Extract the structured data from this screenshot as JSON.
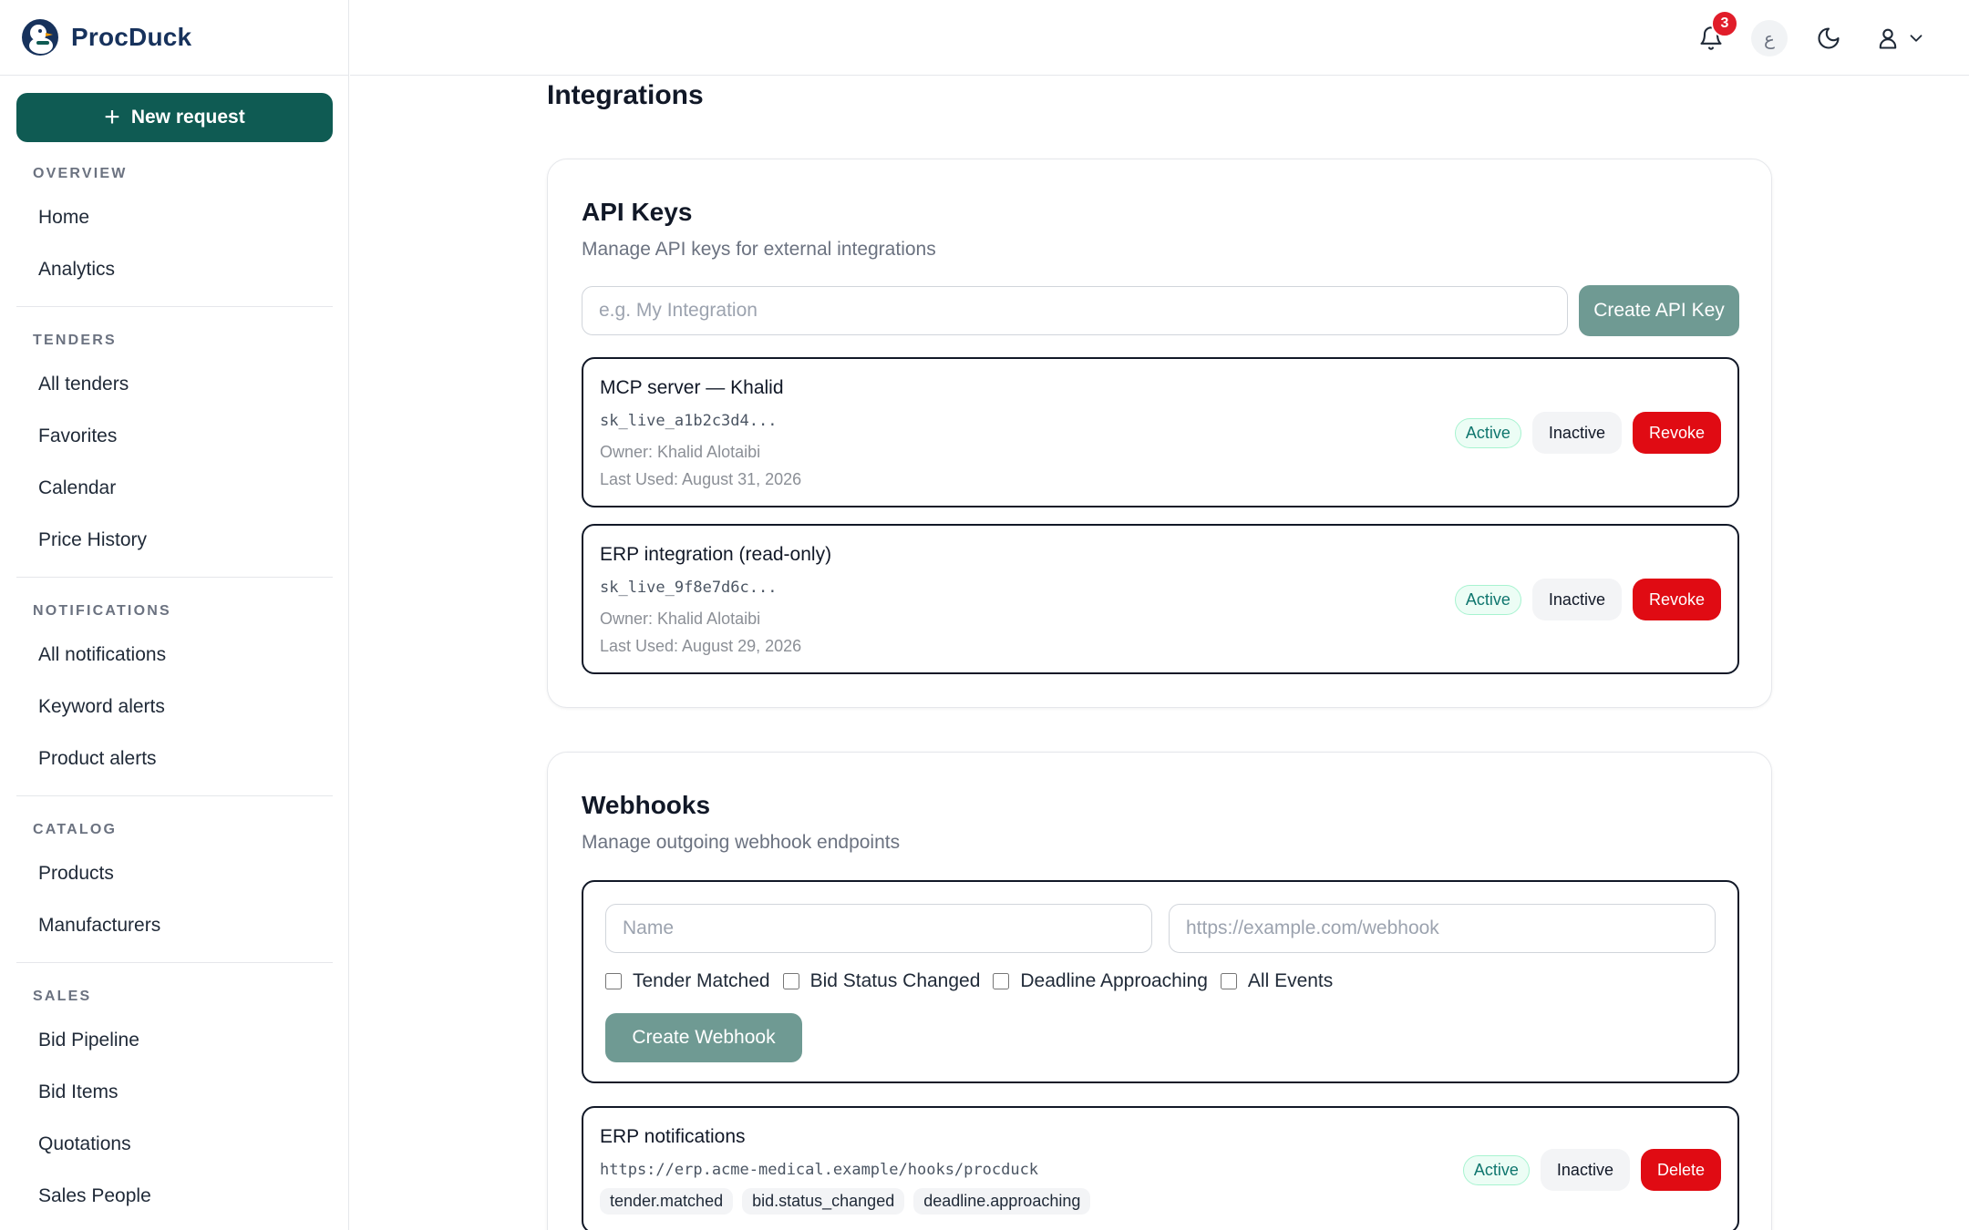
{
  "brand": {
    "name": "ProcDuck"
  },
  "sidebar": {
    "new_request": "New request",
    "sections": [
      {
        "heading": "OVERVIEW",
        "items": [
          "Home",
          "Analytics"
        ]
      },
      {
        "heading": "TENDERS",
        "items": [
          "All tenders",
          "Favorites",
          "Calendar",
          "Price History"
        ]
      },
      {
        "heading": "NOTIFICATIONS",
        "items": [
          "All notifications",
          "Keyword alerts",
          "Product alerts"
        ]
      },
      {
        "heading": "CATALOG",
        "items": [
          "Products",
          "Manufacturers"
        ]
      },
      {
        "heading": "SALES",
        "items": [
          "Bid Pipeline",
          "Bid Items",
          "Quotations",
          "Sales People"
        ]
      }
    ]
  },
  "topbar": {
    "notification_count": "3",
    "language_label": "ع",
    "icons": [
      "bell-icon",
      "language-icon",
      "moon-icon",
      "user-icon",
      "chevron-down-icon"
    ]
  },
  "page": {
    "title": "Integrations"
  },
  "api_keys": {
    "title": "API Keys",
    "subtitle": "Manage API keys for external integrations",
    "name_placeholder": "e.g. My Integration",
    "create_label": "Create API Key",
    "keys": [
      {
        "name": "MCP server — Khalid",
        "key": "sk_live_a1b2c3d4...",
        "owner": "Owner: Khalid Alotaibi",
        "last_used": "Last Used: August 31, 2026",
        "status": "Active",
        "toggle_label": "Inactive",
        "revoke_label": "Revoke"
      },
      {
        "name": "ERP integration (read-only)",
        "key": "sk_live_9f8e7d6c...",
        "owner": "Owner: Khalid Alotaibi",
        "last_used": "Last Used: August 29, 2026",
        "status": "Active",
        "toggle_label": "Inactive",
        "revoke_label": "Revoke"
      }
    ]
  },
  "webhooks": {
    "title": "Webhooks",
    "subtitle": "Manage outgoing webhook endpoints",
    "name_placeholder": "Name",
    "url_placeholder": "https://example.com/webhook",
    "events": [
      "Tender Matched",
      "Bid Status Changed",
      "Deadline Approaching",
      "All Events"
    ],
    "create_label": "Create Webhook",
    "items": [
      {
        "name": "ERP notifications",
        "url": "https://erp.acme-medical.example/hooks/procduck",
        "tags": [
          "tender.matched",
          "bid.status_changed",
          "deadline.approaching"
        ],
        "status": "Active",
        "toggle_label": "Inactive",
        "delete_label": "Delete"
      }
    ]
  },
  "colors": {
    "brand": "#0f5b53",
    "brand_muted": "#6f9a93",
    "danger": "#e00b13",
    "badge": "#e11d2a",
    "brand_text": "#17325c"
  }
}
